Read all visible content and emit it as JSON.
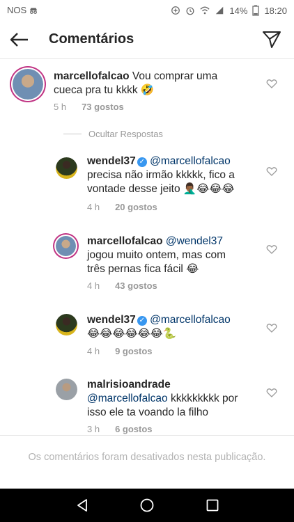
{
  "status_bar": {
    "carrier": "NOS",
    "battery": "14%",
    "time": "18:20"
  },
  "header": {
    "title": "Comentários"
  },
  "comments": [
    {
      "username": "marcellofalcao",
      "verified": false,
      "mention": "",
      "text_line1": "Vou comprar uma",
      "text_line2": "cueca pra tu kkkk 🤣",
      "time": "5 h",
      "likes": "73 gostos"
    },
    {
      "username": "wendel37",
      "verified": true,
      "mention": "@marcellofalcao",
      "text_line1": "precisa não irmão kkkkk, fico a",
      "text_line2": "vontade desse jeito 🤦🏾‍♂️😂😂😂",
      "time": "4 h",
      "likes": "20 gostos"
    },
    {
      "username": "marcellofalcao",
      "verified": false,
      "mention": "@wendel37",
      "text_line1": "jogou muito ontem, mas com",
      "text_line2": "três pernas fica fácil 😂",
      "time": "4 h",
      "likes": "43 gostos"
    },
    {
      "username": "wendel37",
      "verified": true,
      "mention": "@marcellofalcao",
      "text_line1": "😂😂😂😂😂😂🐍",
      "text_line2": "",
      "time": "4 h",
      "likes": "9 gostos"
    },
    {
      "username": "malrisioandrade",
      "verified": false,
      "mention": "@marcellofalcao",
      "text_line1": "kkkkkkkkk por",
      "text_line2": "isso ele ta voando la filho",
      "time": "3 h",
      "likes": "6 gostos"
    }
  ],
  "hide_replies_label": "Ocultar Respostas",
  "comments_disabled": "Os comentários foram desativados nesta publicação.",
  "icons": {
    "back": "back-arrow-icon",
    "send": "send-icon",
    "heart": "heart-icon",
    "verified": "verified-badge-icon"
  },
  "colors": {
    "mention": "#003569",
    "verified": "#3897f0",
    "story_ring": "#c13584"
  }
}
